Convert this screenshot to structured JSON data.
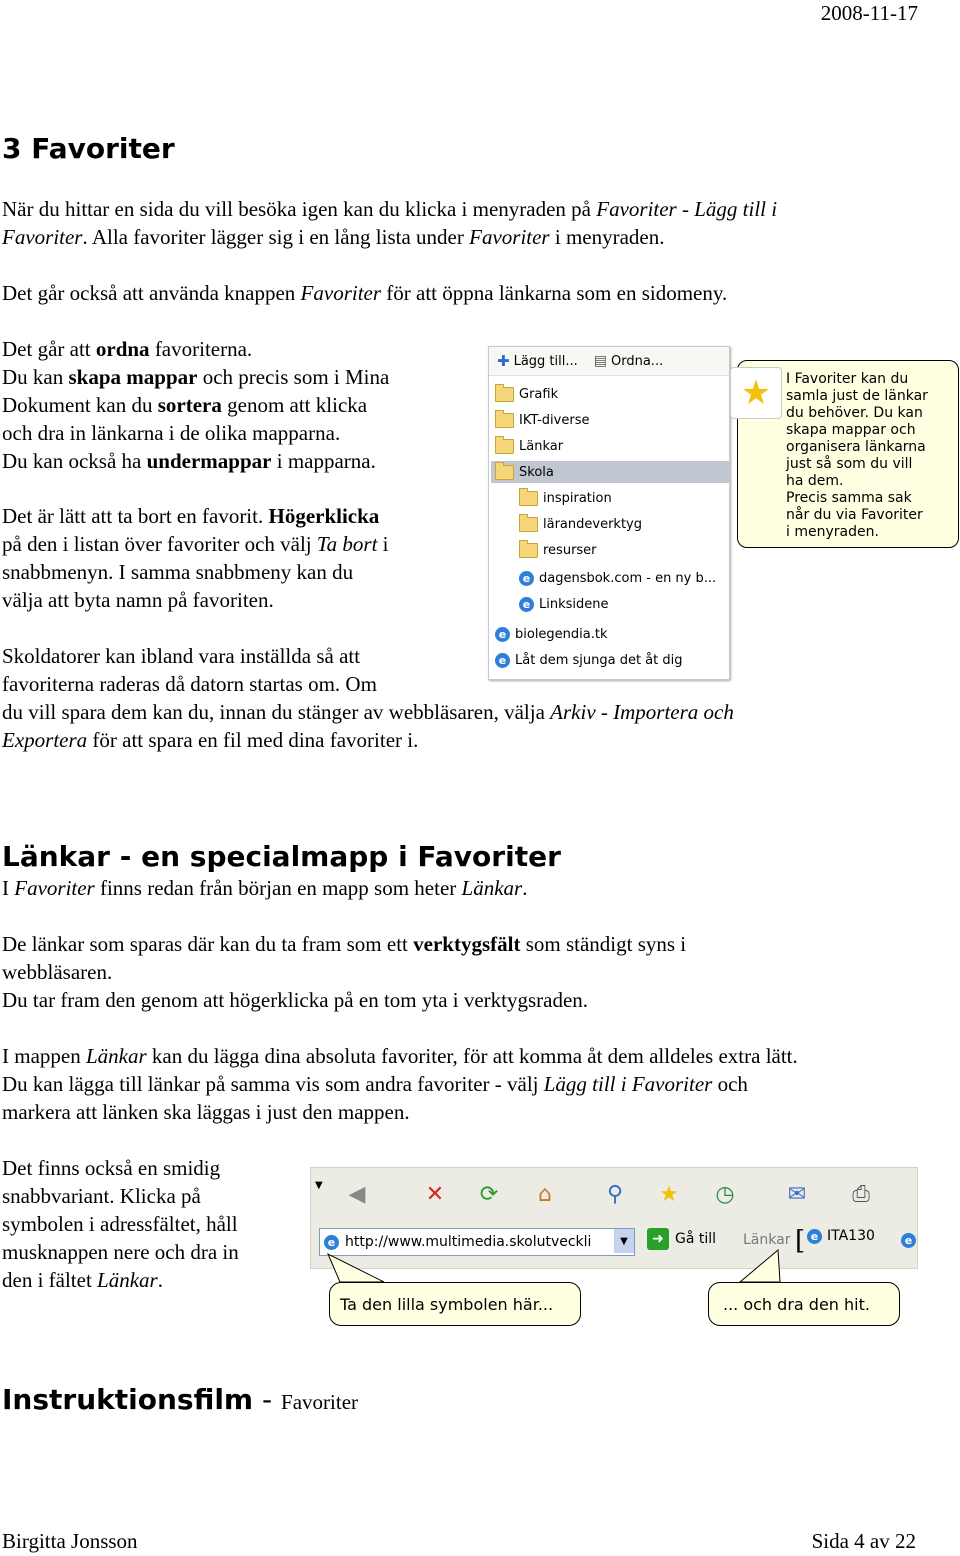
{
  "header": {
    "date": "2008-11-17"
  },
  "section1": {
    "title": "3 Favoriter",
    "p1": [
      [
        {
          "t": "När du hittar en sida du vill besöka igen kan du klicka i menyraden på "
        },
        {
          "t": "Favoriter - Lägg till i",
          "i": true
        }
      ],
      [
        {
          "t": "Favoriter",
          "i": true
        },
        {
          "t": ". Alla favoriter lägger sig i en lång lista under "
        },
        {
          "t": "Favoriter",
          "i": true
        },
        {
          "t": " i menyraden."
        }
      ]
    ],
    "p2": [
      [
        {
          "t": "Det går också att använda knappen "
        },
        {
          "t": "Favoriter",
          "i": true
        },
        {
          "t": " för att öppna länkarna som en sidomeny."
        }
      ]
    ],
    "p3": [
      [
        {
          "t": "Det går att "
        },
        {
          "t": "ordna",
          "b": true
        },
        {
          "t": " favoriterna."
        }
      ],
      [
        {
          "t": "Du kan "
        },
        {
          "t": "skapa mappar",
          "b": true
        },
        {
          "t": " och precis som i Mina"
        }
      ],
      [
        {
          "t": "Dokument kan du "
        },
        {
          "t": "sortera",
          "b": true
        },
        {
          "t": " genom att klicka"
        }
      ],
      [
        {
          "t": "och dra in länkarna i de olika mapparna."
        }
      ],
      [
        {
          "t": "Du kan också ha "
        },
        {
          "t": "undermappar",
          "b": true
        },
        {
          "t": " i mapparna."
        }
      ]
    ],
    "p4": [
      [
        {
          "t": "Det är lätt att ta bort en favorit. "
        },
        {
          "t": "Högerklicka",
          "b": true
        }
      ],
      [
        {
          "t": "på den i listan över favoriter och välj "
        },
        {
          "t": "Ta bort",
          "i": true
        },
        {
          "t": " i"
        }
      ],
      [
        {
          "t": "snabbmenyn. I samma snabbmeny kan du"
        }
      ],
      [
        {
          "t": "välja att byta namn på favoriten."
        }
      ]
    ],
    "p5": [
      [
        {
          "t": "Skoldatorer kan ibland vara inställda så att"
        }
      ],
      [
        {
          "t": "favoriterna raderas då datorn startas om. Om"
        }
      ],
      [
        {
          "t": "du vill spara dem kan du, innan du stänger av webbläsaren, välja "
        },
        {
          "t": "Arkiv - Importera och",
          "i": true
        }
      ],
      [
        {
          "t": "Exportera",
          "i": true
        },
        {
          "t": " för att spara en fil med dina favoriter i."
        }
      ]
    ]
  },
  "favorites_panel": {
    "add_label": "Lägg till...",
    "organize_label": "Ordna...",
    "items": [
      {
        "label": "Grafik",
        "kind": "folder"
      },
      {
        "label": "IKT-diverse",
        "kind": "folder"
      },
      {
        "label": "Länkar",
        "kind": "folder"
      },
      {
        "label": "Skola",
        "kind": "folder",
        "selected": true
      },
      {
        "label": "inspiration",
        "kind": "folder",
        "indent": true
      },
      {
        "label": "lärandeverktyg",
        "kind": "folder",
        "indent": true
      },
      {
        "label": "resurser",
        "kind": "folder",
        "indent": true
      },
      {
        "label": "dagensbok.com - en ny b...",
        "kind": "link",
        "indent": true
      },
      {
        "label": "Linksidene",
        "kind": "link",
        "indent": true
      },
      {
        "label": "biolegendia.tk",
        "kind": "link"
      },
      {
        "label": "Låt dem sjunga det åt dig",
        "kind": "link"
      }
    ],
    "callout_lines": [
      "I Favoriter kan du",
      "samla just de länkar",
      "du behöver. Du kan",
      "skapa mappar och",
      "organisera länkarna",
      "just så som du vill",
      "ha dem.",
      "Precis samma sak",
      "når du via Favoriter",
      "i menyraden."
    ]
  },
  "section2": {
    "title": "Länkar - en specialmapp i Favoriter",
    "p1": [
      [
        {
          "t": "I "
        },
        {
          "t": "Favoriter",
          "i": true
        },
        {
          "t": " finns redan från början en mapp som heter "
        },
        {
          "t": "Länkar",
          "i": true
        },
        {
          "t": "."
        }
      ]
    ],
    "p2": [
      [
        {
          "t": "De länkar som sparas där kan du ta fram som ett "
        },
        {
          "t": "verktygsfält",
          "b": true
        },
        {
          "t": " som ständigt syns i"
        }
      ],
      [
        {
          "t": "webbläsaren."
        }
      ],
      [
        {
          "t": "Du tar fram den genom att högerklicka på en tom yta i verktygsraden."
        }
      ]
    ],
    "p3": [
      [
        {
          "t": "I mappen "
        },
        {
          "t": "Länkar",
          "i": true
        },
        {
          "t": " kan du lägga dina absoluta favoriter, för att komma åt dem alldeles extra lätt."
        }
      ],
      [
        {
          "t": "Du kan lägga till länkar på samma vis som andra favoriter - välj "
        },
        {
          "t": "Lägg till i Favoriter",
          "i": true
        },
        {
          "t": " och"
        }
      ],
      [
        {
          "t": "markera att länken ska läggas i just den mappen."
        }
      ]
    ],
    "p4": [
      [
        {
          "t": "Det finns också en smidig"
        }
      ],
      [
        {
          "t": "snabbvariant. Klicka på"
        }
      ],
      [
        {
          "t": "symbolen i adressfältet, håll"
        }
      ],
      [
        {
          "t": "musknappen nere och dra in"
        }
      ],
      [
        {
          "t": "den i fältet "
        },
        {
          "t": "Länkar",
          "i": true
        },
        {
          "t": "."
        }
      ]
    ]
  },
  "toolbar": {
    "address": "http://www.multimedia.skolutveckli",
    "go_label": "Gå till",
    "links_label": "Länkar",
    "link1": "ITA130",
    "callout_left": "Ta den lilla symbolen här...",
    "callout_right": "... och dra den hit.",
    "icons": [
      "back-icon",
      "stop-icon",
      "refresh-icon",
      "home-icon",
      "search-icon",
      "favorites-star-icon",
      "history-icon",
      "mail-icon",
      "print-icon"
    ]
  },
  "section3": {
    "title": "Instruktionsfilm",
    "sep": " - ",
    "subtitle": "Favoriter"
  },
  "footer": {
    "author": "Birgitta Jonsson",
    "page": "Sida 4 av 22"
  }
}
